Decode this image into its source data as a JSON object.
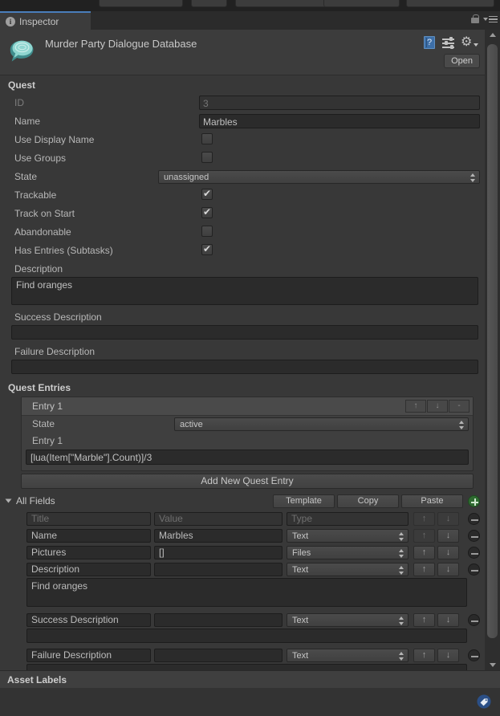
{
  "window": {
    "tab_label": "Inspector",
    "tab_icon": "info-icon",
    "lock_icon": "lock-icon",
    "menu_icon": "hamburger-menu-icon"
  },
  "object_header": {
    "title": "Murder Party Dialogue Database",
    "icon": "dialogue-database-icon",
    "help_icon": "help-book-icon",
    "preset_icon": "preset-slider-icon",
    "settings_icon": "gear-icon",
    "open_button": "Open"
  },
  "quest": {
    "section_title": "Quest",
    "fields": [
      {
        "label": "ID",
        "value": "3",
        "type": "text",
        "disabled": true
      },
      {
        "label": "Name",
        "value": "Marbles",
        "type": "text",
        "disabled": false
      },
      {
        "label": "Use Display Name",
        "value": false,
        "type": "checkbox"
      },
      {
        "label": "Use Groups",
        "value": false,
        "type": "checkbox"
      },
      {
        "label": "State",
        "value": "unassigned",
        "type": "dropdown"
      },
      {
        "label": "Trackable",
        "value": true,
        "type": "checkbox"
      },
      {
        "label": "Track on Start",
        "value": true,
        "type": "checkbox"
      },
      {
        "label": "Abandonable",
        "value": false,
        "type": "checkbox"
      },
      {
        "label": "Has Entries (Subtasks)",
        "value": true,
        "type": "checkbox"
      }
    ],
    "description_label": "Description",
    "description_value": "Find oranges",
    "success_label": "Success Description",
    "success_value": "",
    "failure_label": "Failure Description",
    "failure_value": ""
  },
  "quest_entries": {
    "section_title": "Quest Entries",
    "entry_header": "Entry 1",
    "move_up_label": "↑",
    "move_down_label": "↓",
    "remove_label": "-",
    "state_label": "State",
    "state_value": "active",
    "entry_text_label": "Entry 1",
    "entry_text_value": "[lua(Item[\"Marble\"].Count)]/3",
    "add_button": "Add New Quest Entry"
  },
  "all_fields": {
    "section_title": "All Fields",
    "template_button": "Template",
    "copy_button": "Copy",
    "paste_button": "Paste",
    "add_icon": "plus-circle-icon",
    "remove_icon": "minus-circle-icon",
    "headers": {
      "title": "Title",
      "value": "Value",
      "type": "Type"
    },
    "rows": [
      {
        "title": "Name",
        "value": "Marbles",
        "type": "Text",
        "textarea": null
      },
      {
        "title": "Pictures",
        "value": "[]",
        "type": "Files",
        "textarea": null
      },
      {
        "title": "Description",
        "value": "",
        "type": "Text",
        "textarea": "Find oranges"
      },
      {
        "title": "Success Description",
        "value": "",
        "type": "Text",
        "textarea": ""
      },
      {
        "title": "Failure Description",
        "value": "",
        "type": "Text",
        "textarea": ""
      }
    ]
  },
  "footer": {
    "asset_labels": "Asset Labels",
    "tag_icon": "tag-icon",
    "accent_color": "#4a7ebb",
    "add_color": "#2f6b31"
  }
}
